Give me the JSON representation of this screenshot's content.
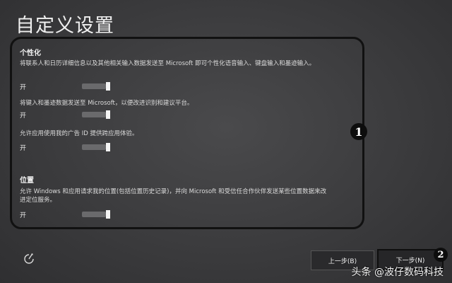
{
  "page": {
    "title": "自定义设置"
  },
  "personalization": {
    "heading": "个性化",
    "items": [
      {
        "text": "将联系人和日历详细信息以及其他相关输入数据发送至 Microsoft 即可个性化语音输入、键盘输入和墨迹输入。",
        "toggle_label": "开",
        "on": true
      },
      {
        "text": "将键入和墨迹数据发送至 Microsoft，以便改进识别和建议平台。",
        "toggle_label": "开",
        "on": true
      },
      {
        "text": "允许应用使用我的广告 ID 提供跨应用体验。",
        "toggle_label": "开",
        "on": true
      }
    ]
  },
  "location": {
    "heading": "位置",
    "items": [
      {
        "text": "允许 Windows 和应用请求我的位置(包括位置历史记录)，并向 Microsoft 和受信任合作伙伴发送某些位置数据来改进定位服务。",
        "toggle_label": "开",
        "on": true
      }
    ]
  },
  "callouts": {
    "one": "1",
    "two": "2"
  },
  "footer": {
    "back_label": "上一步(B)",
    "next_label": "下一步(N)",
    "accessibility_icon": "ease-of-access-icon"
  },
  "watermark": "头条 @波仔数码科技"
}
